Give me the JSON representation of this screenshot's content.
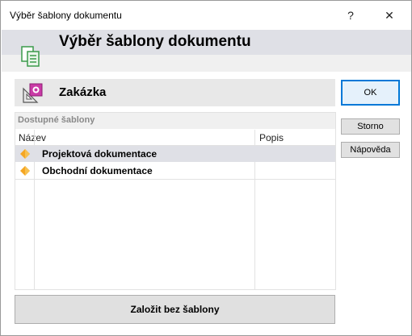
{
  "window": {
    "title": "Výběr šablony dokumentu",
    "help_glyph": "?",
    "close_glyph": "✕"
  },
  "header": {
    "title": "Výběr šablony dokumentu",
    "icon": "document-template-icon"
  },
  "section": {
    "title": "Zakázka",
    "icon": "project-order-icon"
  },
  "grid": {
    "group_label": "Dostupné šablony",
    "columns": [
      "Název",
      "Popis"
    ],
    "rows": [
      {
        "name": "Projektová dokumentace",
        "description": "",
        "selected": true,
        "icon": "diamond-icon"
      },
      {
        "name": "Obchodní dokumentace",
        "description": "",
        "selected": false,
        "icon": "diamond-icon"
      }
    ]
  },
  "buttons": {
    "ok": "OK",
    "cancel": "Storno",
    "help": "Nápověda",
    "create_without_template": "Založit bez šablony"
  },
  "colors": {
    "accent": "#0078d7",
    "selection": "#dfe0e6",
    "diamond": "#f5a623"
  }
}
